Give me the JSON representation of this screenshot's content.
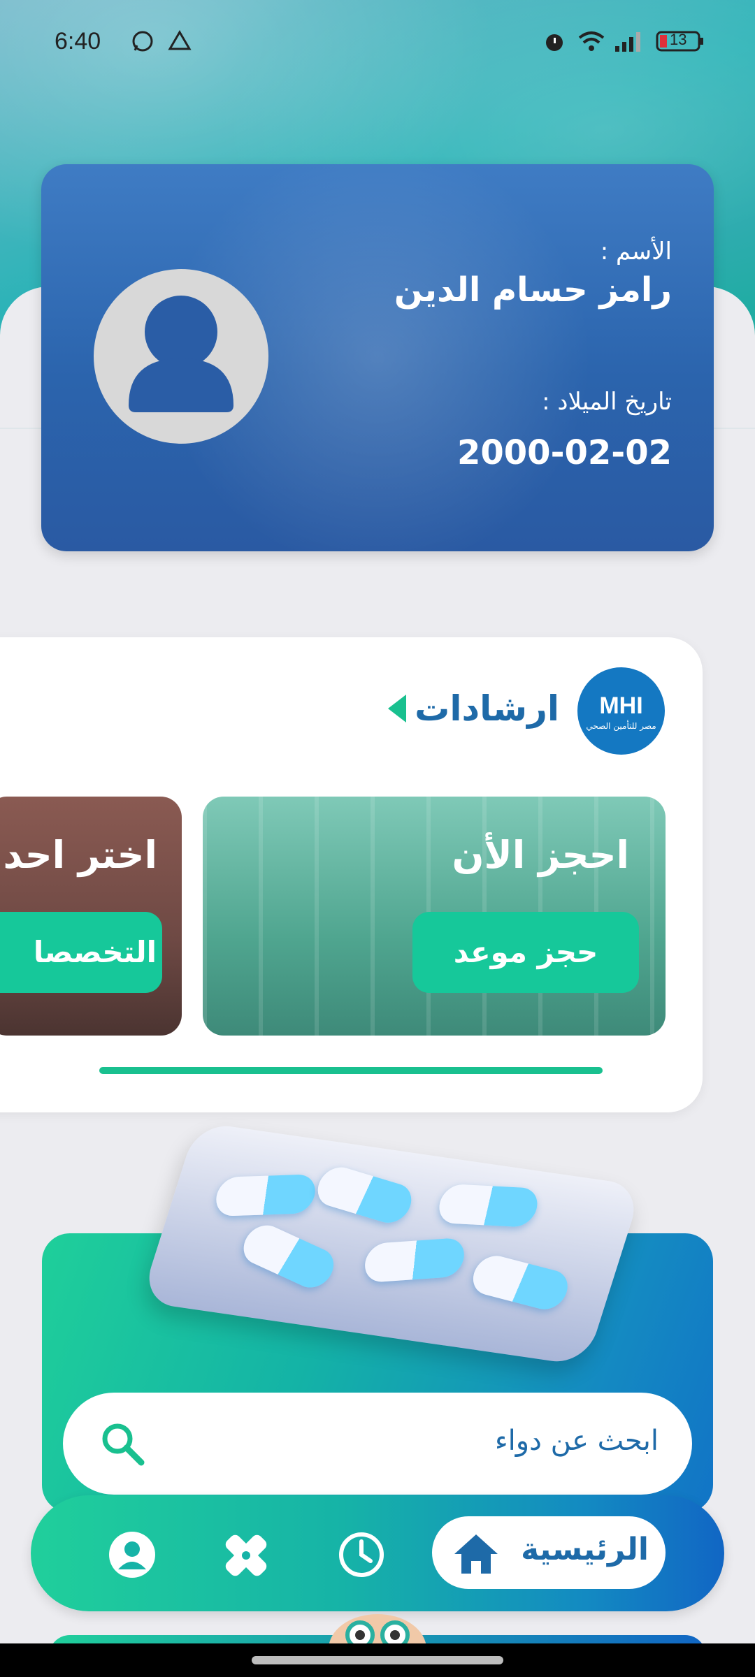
{
  "status_bar": {
    "time": "6:40",
    "battery": "13",
    "icons": [
      "whatsapp-icon",
      "drive-icon",
      "alarm-icon",
      "wifi-icon",
      "signal-icon",
      "battery-icon"
    ]
  },
  "id_card": {
    "name_label": "الأسم :",
    "name_value": "رامز حسام الدين",
    "dob_label": "تاريخ الميلاد :",
    "dob_value": "2000-02-02"
  },
  "tips": {
    "title": "ارشادات",
    "logo_text": "MHI",
    "logo_subtext": "مصر للتأمين الصحي",
    "slides": [
      {
        "title": "احجز الأن",
        "button": "حجز موعد"
      },
      {
        "title": "اختر احد ال",
        "button": "التخصصا"
      }
    ]
  },
  "medicine": {
    "search_placeholder": "ابحث عن دواء"
  },
  "nav": {
    "home_label": "الرئيسية",
    "items": [
      "home-icon",
      "history-icon",
      "medical-icon",
      "profile-icon"
    ]
  },
  "colors": {
    "primary_blue": "#1e6aa8",
    "accent_green": "#16c89a",
    "card_blue": "#2b64ad"
  }
}
